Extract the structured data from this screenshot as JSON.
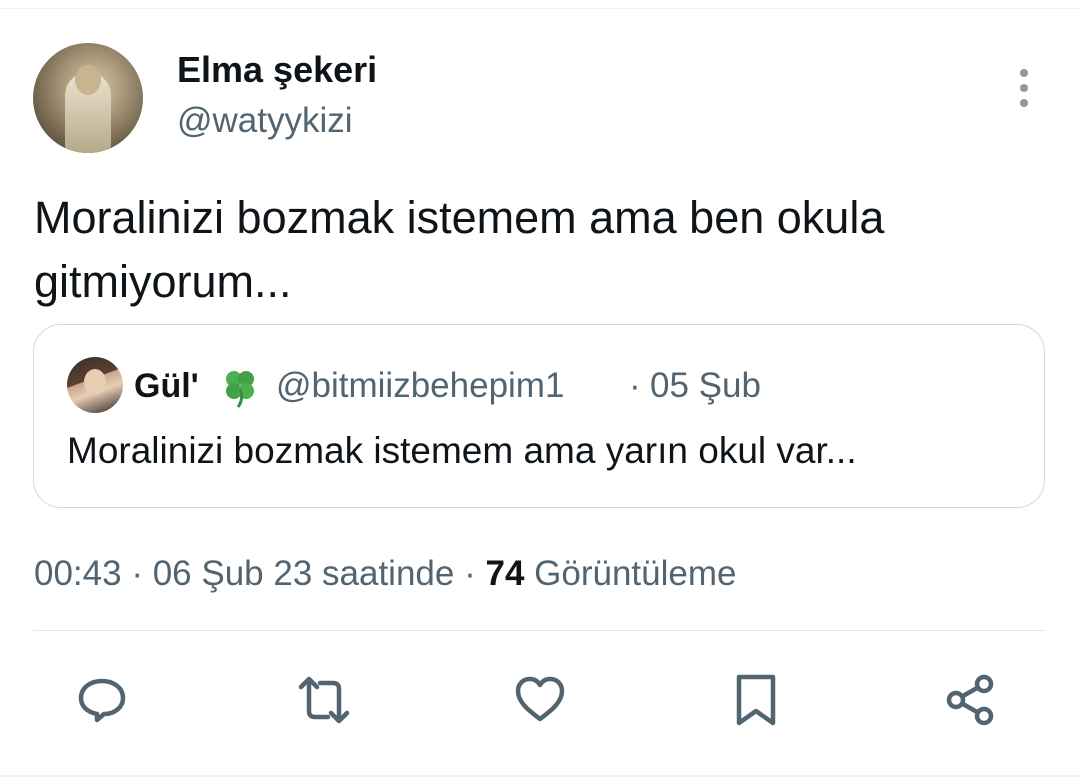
{
  "tweet": {
    "author_name": "Elma şekeri",
    "author_handle": "@watyykizi",
    "text": "Moralinizi bozmak istemem ama ben okula gitmiyorum...",
    "time": "00:43",
    "separator": "·",
    "date": "06 Şub 23 saatinde",
    "views_count": "74",
    "views_label": "Görüntüleme"
  },
  "quote": {
    "author_name": "Gül'",
    "author_handle": "@bitmiizbehepim1",
    "separator": "·",
    "date": "05 Şub",
    "text": "Moralinizi bozmak istemem ama yarın okul var..."
  },
  "icons": {
    "more": "more-vertical-icon",
    "reply": "reply-icon",
    "retweet": "retweet-icon",
    "like": "heart-icon",
    "bookmark": "bookmark-icon",
    "share": "share-icon",
    "emoji": "four-leaf-clover-icon"
  },
  "colors": {
    "text_primary": "#0f1419",
    "text_secondary": "#536471",
    "border": "#cfd9de",
    "icon": "#536471",
    "clover": "#4caf50"
  }
}
